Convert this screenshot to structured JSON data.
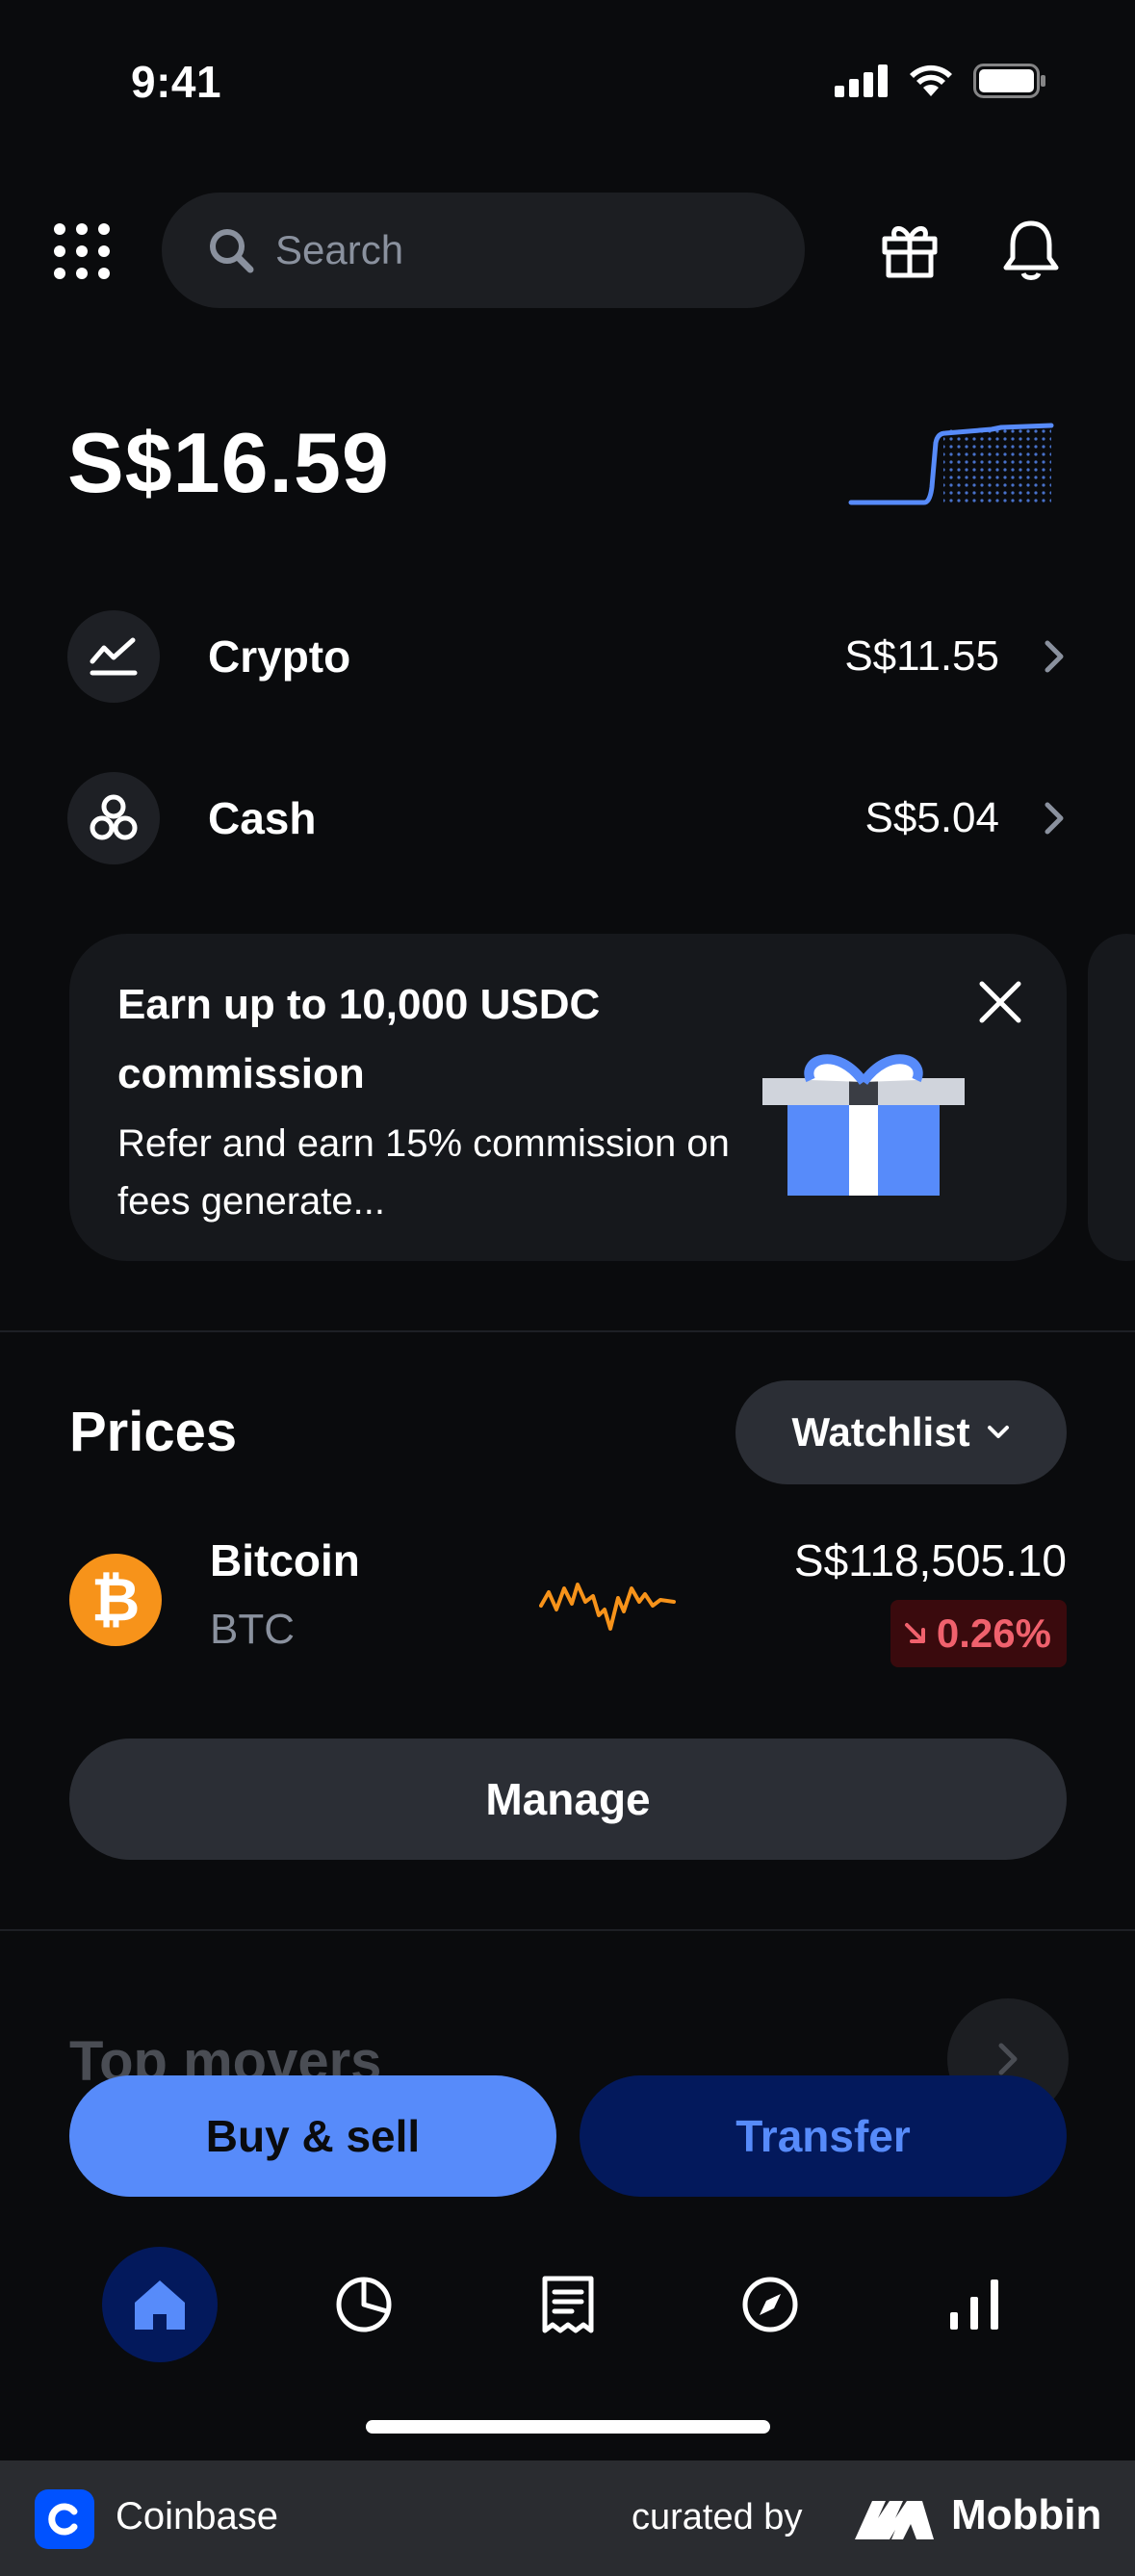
{
  "status_bar": {
    "time": "9:41"
  },
  "header": {
    "search_placeholder": "Search"
  },
  "balance": {
    "total": "S$16.59"
  },
  "accounts": [
    {
      "label": "Crypto",
      "value": "S$11.55",
      "icon": "chart-line-icon"
    },
    {
      "label": "Cash",
      "value": "S$5.04",
      "icon": "coins-icon"
    }
  ],
  "promo": {
    "title": "Earn up to 10,000 USDC commission",
    "body": "Refer and earn 15% commission on fees generate..."
  },
  "prices": {
    "title": "Prices",
    "filter_label": "Watchlist",
    "coins": [
      {
        "name": "Bitcoin",
        "symbol": "BTC",
        "price": "S$118,505.10",
        "change": "0.26%",
        "direction": "down"
      }
    ],
    "manage_label": "Manage"
  },
  "top_movers": {
    "title": "Top movers"
  },
  "actions": {
    "buy_sell": "Buy & sell",
    "transfer": "Transfer"
  },
  "nav": [
    {
      "name": "home",
      "icon": "home-icon",
      "active": true
    },
    {
      "name": "portfolio",
      "icon": "pie-chart-icon",
      "active": false
    },
    {
      "name": "transactions",
      "icon": "receipt-icon",
      "active": false
    },
    {
      "name": "explore",
      "icon": "compass-icon",
      "active": false
    },
    {
      "name": "markets",
      "icon": "bar-chart-icon",
      "active": false
    }
  ],
  "footer": {
    "app_name": "Coinbase",
    "curated_by": "curated by",
    "brand": "Mobbin"
  },
  "colors": {
    "background": "#0a0b0d",
    "primary": "#578bfa",
    "primary_dark": "#03195c",
    "negative": "#f0616d",
    "bitcoin": "#f7931a"
  }
}
